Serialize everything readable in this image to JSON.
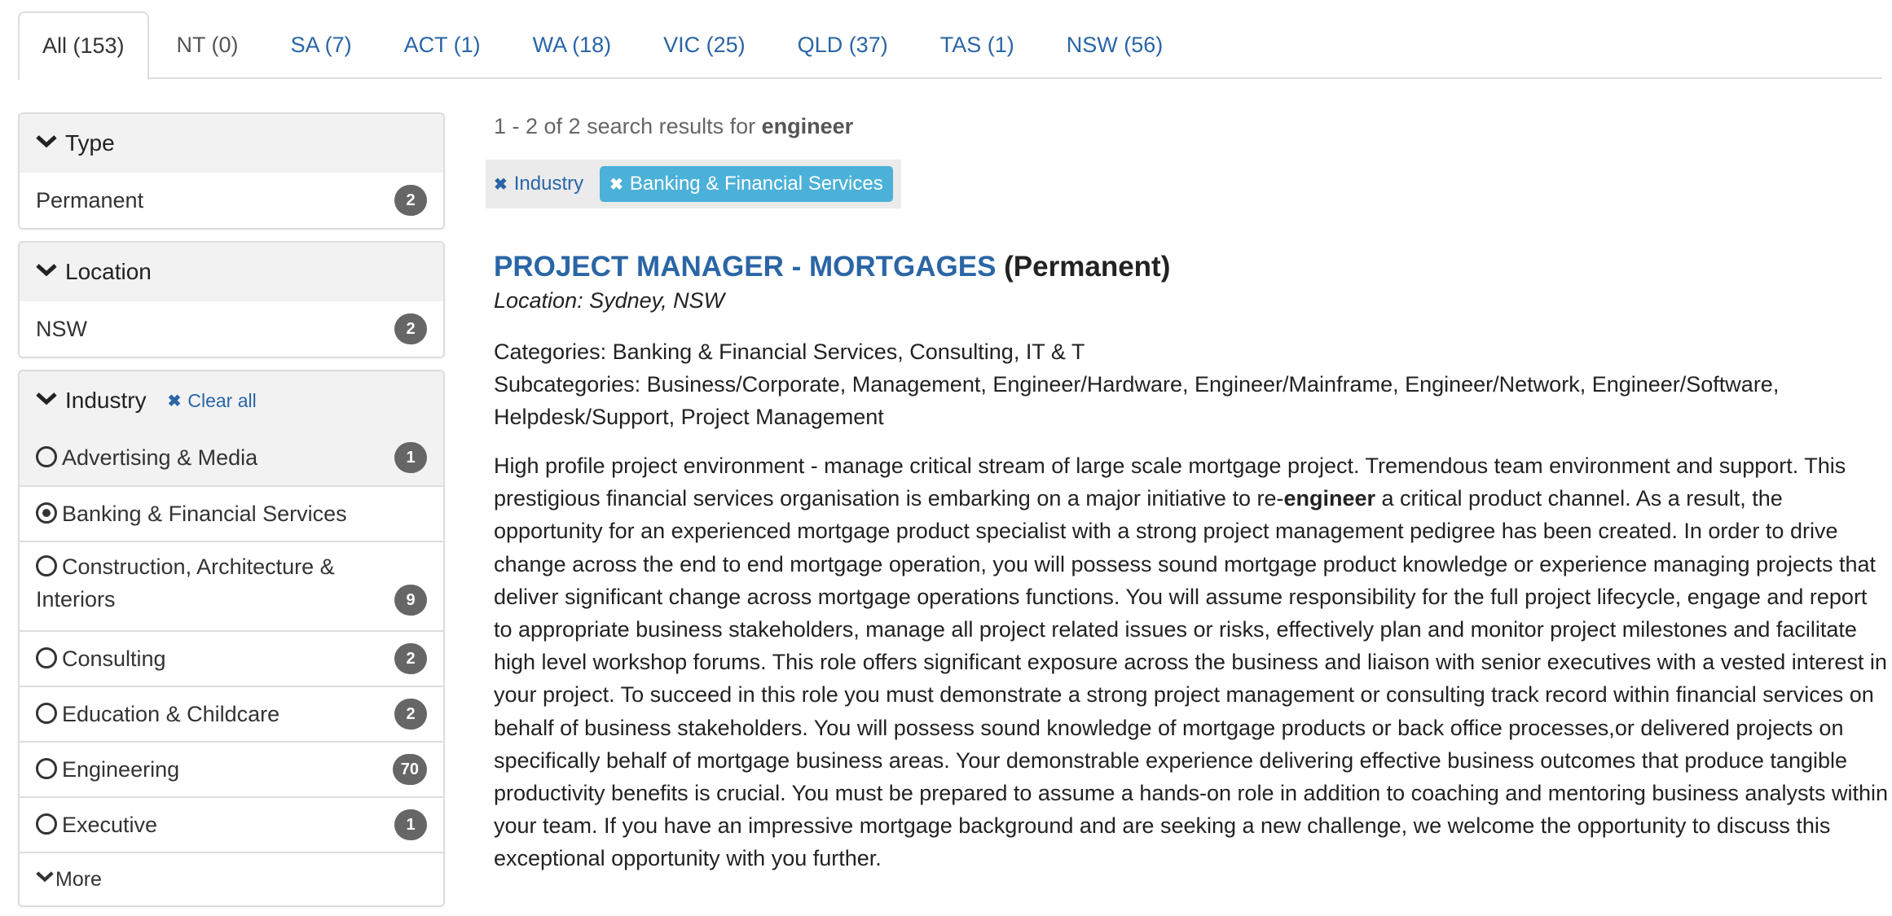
{
  "tabs": [
    {
      "label": "All (153)",
      "state": "active"
    },
    {
      "label": "NT (0)",
      "state": "disabled"
    },
    {
      "label": "SA (7)",
      "state": "link"
    },
    {
      "label": "ACT (1)",
      "state": "link"
    },
    {
      "label": "WA (18)",
      "state": "link"
    },
    {
      "label": "VIC (25)",
      "state": "link"
    },
    {
      "label": "QLD (37)",
      "state": "link"
    },
    {
      "label": "TAS (1)",
      "state": "link"
    },
    {
      "label": "NSW (56)",
      "state": "link"
    }
  ],
  "sidebar": {
    "type": {
      "title": "Type",
      "items": [
        {
          "label": "Permanent",
          "count": "2"
        }
      ]
    },
    "location": {
      "title": "Location",
      "items": [
        {
          "label": "NSW",
          "count": "2"
        }
      ]
    },
    "industry": {
      "title": "Industry",
      "clear_all": "Clear all",
      "items": [
        {
          "label": "Advertising & Media",
          "count": "1",
          "selected": false
        },
        {
          "label": "Banking & Financial Services",
          "count": "",
          "selected": true
        },
        {
          "label": "Construction, Architecture & Interiors",
          "count": "9",
          "selected": false
        },
        {
          "label": "Consulting",
          "count": "2",
          "selected": false
        },
        {
          "label": "Education & Childcare",
          "count": "2",
          "selected": false
        },
        {
          "label": "Engineering",
          "count": "70",
          "selected": false
        },
        {
          "label": "Executive",
          "count": "1",
          "selected": false
        }
      ],
      "more_label": "More"
    }
  },
  "results": {
    "summary_prefix": "1 - 2 of 2 search results for ",
    "query": "engineer",
    "filters": {
      "facet": "Industry",
      "value": "Banking & Financial Services"
    }
  },
  "job": {
    "title": "PROJECT MANAGER - MORTGAGES",
    "type": "(Permanent)",
    "location": "Location: Sydney, NSW",
    "categories": "Categories: Banking & Financial Services, Consulting, IT & T",
    "subcategories": "Subcategories: Business/Corporate, Management, Engineer/Hardware, Engineer/Mainframe, Engineer/Network, Engineer/Software, Helpdesk/Support, Project Management",
    "description_before": "High profile project environment - manage critical stream of large scale mortgage project. Tremendous team environment and support. This prestigious financial services organisation is embarking on a major initiative to re-",
    "description_highlight": "engineer",
    "description_after": " a critical product channel. As a result, the opportunity for an experienced mortgage product specialist with a strong project management pedigree has been created. In order to drive change across the end to end mortgage operation, you will possess sound mortgage product knowledge or experience managing projects that deliver significant change across mortgage operations functions. You will assume responsibility for the full project lifecycle, engage and report to appropriate business stakeholders, manage all project related issues or risks, effectively plan and monitor project milestones and facilitate high level workshop forums. This role offers significant exposure across the business and liaison with senior executives with a vested interest in your project. To succeed in this role you must demonstrate a strong project management or consulting track record within financial services on behalf of business stakeholders. You will possess sound knowledge of mortgage products or back office processes,or delivered projects on specifically behalf of mortgage business areas. Your demonstrable experience delivering effective business outcomes that produce tangible productivity benefits is crucial. You must be prepared to assume a hands-on role in addition to coaching and mentoring business analysts within your team. If you have an impressive mortgage background and are seeking a new challenge, we welcome the opportunity to discuss this exceptional opportunity with you further."
  },
  "icons": {
    "chevron": "chevron-down-icon",
    "remove": "times-icon",
    "radio_off": "radio-unchecked-icon",
    "radio_on": "radio-checked-icon"
  },
  "colors": {
    "link": "#2a65a6",
    "badge": "#666666",
    "active_filter": "#4cb1d8",
    "panel_header": "#f2f2f2",
    "border": "#dddddd"
  }
}
